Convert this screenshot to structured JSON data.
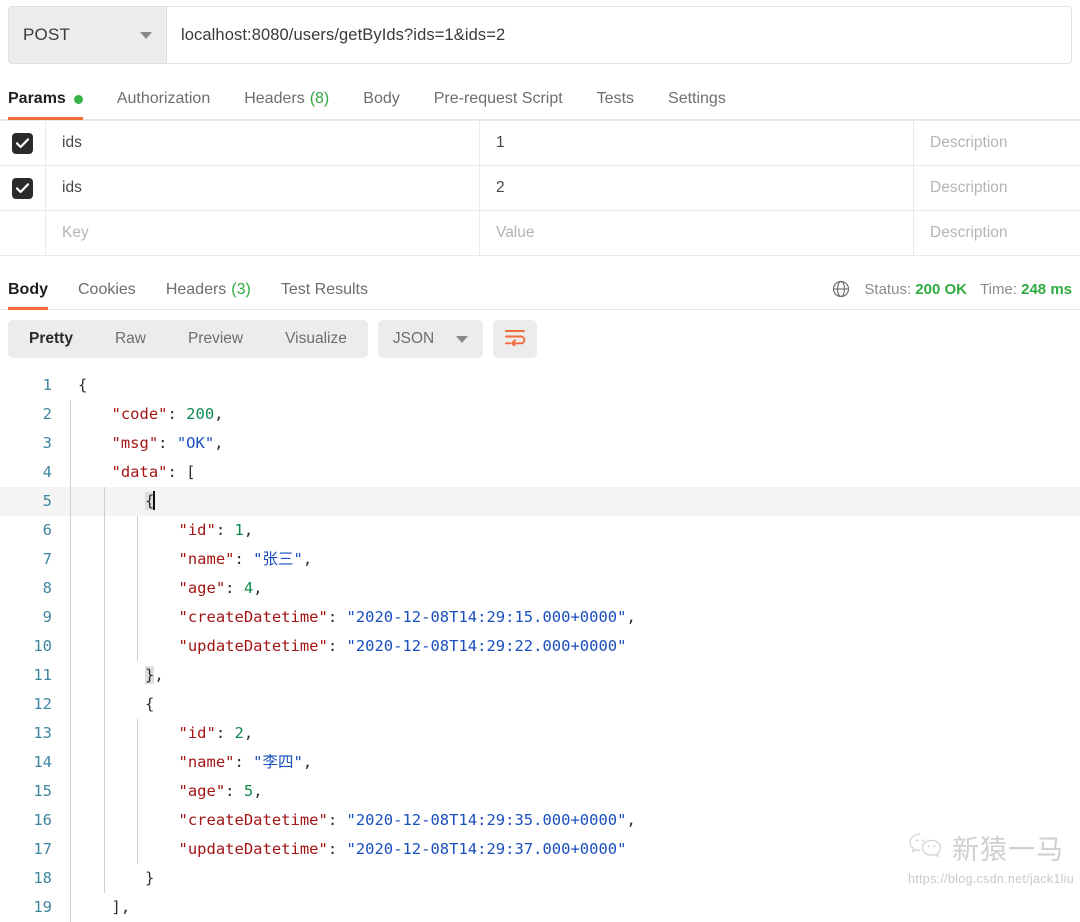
{
  "request": {
    "method": "POST",
    "url": "localhost:8080/users/getByIds?ids=1&ids=2",
    "method_caret_icon": "chevron-down-icon"
  },
  "request_tabs": [
    {
      "label": "Params",
      "badge": "",
      "dot": true,
      "active": true
    },
    {
      "label": "Authorization",
      "badge": "",
      "dot": false,
      "active": false
    },
    {
      "label": "Headers",
      "badge": "(8)",
      "dot": false,
      "active": false
    },
    {
      "label": "Body",
      "badge": "",
      "dot": false,
      "active": false
    },
    {
      "label": "Pre-request Script",
      "badge": "",
      "dot": false,
      "active": false
    },
    {
      "label": "Tests",
      "badge": "",
      "dot": false,
      "active": false
    },
    {
      "label": "Settings",
      "badge": "",
      "dot": false,
      "active": false
    }
  ],
  "params": {
    "placeholders": {
      "key": "Key",
      "value": "Value",
      "description": "Description"
    },
    "rows": [
      {
        "checked": true,
        "key": "ids",
        "value": "1",
        "description": ""
      },
      {
        "checked": true,
        "key": "ids",
        "value": "2",
        "description": ""
      },
      {
        "checked": false,
        "key": "",
        "value": "",
        "description": ""
      }
    ]
  },
  "response_tabs": [
    {
      "label": "Body",
      "badge": "",
      "active": true
    },
    {
      "label": "Cookies",
      "badge": "",
      "active": false
    },
    {
      "label": "Headers",
      "badge": "(3)",
      "active": false
    },
    {
      "label": "Test Results",
      "badge": "",
      "active": false
    }
  ],
  "response_meta": {
    "globe_icon": "globe-icon",
    "status_label": "Status:",
    "status_value": "200 OK",
    "time_label": "Time:",
    "time_value": "248 ms"
  },
  "view_toolbar": {
    "modes": [
      {
        "label": "Pretty",
        "active": true
      },
      {
        "label": "Raw",
        "active": false
      },
      {
        "label": "Preview",
        "active": false
      },
      {
        "label": "Visualize",
        "active": false
      }
    ],
    "format": "JSON",
    "format_caret_icon": "chevron-down-icon",
    "wrap_icon": "word-wrap-icon"
  },
  "response_body": {
    "lines": [
      {
        "n": "1",
        "indent": 0,
        "guides": 0,
        "highlight": false,
        "tokens": [
          {
            "t": "{",
            "c": "jpunc"
          }
        ]
      },
      {
        "n": "2",
        "indent": 1,
        "guides": 1,
        "highlight": false,
        "tokens": [
          {
            "t": "\"code\"",
            "c": "jkey"
          },
          {
            "t": ": ",
            "c": "jpunc"
          },
          {
            "t": "200",
            "c": "jnum"
          },
          {
            "t": ",",
            "c": "jpunc"
          }
        ]
      },
      {
        "n": "3",
        "indent": 1,
        "guides": 1,
        "highlight": false,
        "tokens": [
          {
            "t": "\"msg\"",
            "c": "jkey"
          },
          {
            "t": ": ",
            "c": "jpunc"
          },
          {
            "t": "\"OK\"",
            "c": "jstr"
          },
          {
            "t": ",",
            "c": "jpunc"
          }
        ]
      },
      {
        "n": "4",
        "indent": 1,
        "guides": 1,
        "highlight": false,
        "tokens": [
          {
            "t": "\"data\"",
            "c": "jkey"
          },
          {
            "t": ": ",
            "c": "jpunc"
          },
          {
            "t": "[",
            "c": "jpunc"
          }
        ]
      },
      {
        "n": "5",
        "indent": 2,
        "guides": 2,
        "highlight": true,
        "caret": true,
        "tokens": [
          {
            "t": "{",
            "c": "jpunc brk"
          }
        ]
      },
      {
        "n": "6",
        "indent": 3,
        "guides": 3,
        "highlight": false,
        "tokens": [
          {
            "t": "\"id\"",
            "c": "jkey"
          },
          {
            "t": ": ",
            "c": "jpunc"
          },
          {
            "t": "1",
            "c": "jnum"
          },
          {
            "t": ",",
            "c": "jpunc"
          }
        ]
      },
      {
        "n": "7",
        "indent": 3,
        "guides": 3,
        "highlight": false,
        "tokens": [
          {
            "t": "\"name\"",
            "c": "jkey"
          },
          {
            "t": ": ",
            "c": "jpunc"
          },
          {
            "t": "\"张三\"",
            "c": "jstr"
          },
          {
            "t": ",",
            "c": "jpunc"
          }
        ]
      },
      {
        "n": "8",
        "indent": 3,
        "guides": 3,
        "highlight": false,
        "tokens": [
          {
            "t": "\"age\"",
            "c": "jkey"
          },
          {
            "t": ": ",
            "c": "jpunc"
          },
          {
            "t": "4",
            "c": "jnum"
          },
          {
            "t": ",",
            "c": "jpunc"
          }
        ]
      },
      {
        "n": "9",
        "indent": 3,
        "guides": 3,
        "highlight": false,
        "tokens": [
          {
            "t": "\"createDatetime\"",
            "c": "jkey"
          },
          {
            "t": ": ",
            "c": "jpunc"
          },
          {
            "t": "\"2020-12-08T14:29:15.000+0000\"",
            "c": "jstr"
          },
          {
            "t": ",",
            "c": "jpunc"
          }
        ]
      },
      {
        "n": "10",
        "indent": 3,
        "guides": 3,
        "highlight": false,
        "tokens": [
          {
            "t": "\"updateDatetime\"",
            "c": "jkey"
          },
          {
            "t": ": ",
            "c": "jpunc"
          },
          {
            "t": "\"2020-12-08T14:29:22.000+0000\"",
            "c": "jstr"
          }
        ]
      },
      {
        "n": "11",
        "indent": 2,
        "guides": 2,
        "highlight": false,
        "tokens": [
          {
            "t": "}",
            "c": "jpunc brk"
          },
          {
            "t": ",",
            "c": "jpunc"
          }
        ]
      },
      {
        "n": "12",
        "indent": 2,
        "guides": 2,
        "highlight": false,
        "tokens": [
          {
            "t": "{",
            "c": "jpunc"
          }
        ]
      },
      {
        "n": "13",
        "indent": 3,
        "guides": 3,
        "highlight": false,
        "tokens": [
          {
            "t": "\"id\"",
            "c": "jkey"
          },
          {
            "t": ": ",
            "c": "jpunc"
          },
          {
            "t": "2",
            "c": "jnum"
          },
          {
            "t": ",",
            "c": "jpunc"
          }
        ]
      },
      {
        "n": "14",
        "indent": 3,
        "guides": 3,
        "highlight": false,
        "tokens": [
          {
            "t": "\"name\"",
            "c": "jkey"
          },
          {
            "t": ": ",
            "c": "jpunc"
          },
          {
            "t": "\"李四\"",
            "c": "jstr"
          },
          {
            "t": ",",
            "c": "jpunc"
          }
        ]
      },
      {
        "n": "15",
        "indent": 3,
        "guides": 3,
        "highlight": false,
        "tokens": [
          {
            "t": "\"age\"",
            "c": "jkey"
          },
          {
            "t": ": ",
            "c": "jpunc"
          },
          {
            "t": "5",
            "c": "jnum"
          },
          {
            "t": ",",
            "c": "jpunc"
          }
        ]
      },
      {
        "n": "16",
        "indent": 3,
        "guides": 3,
        "highlight": false,
        "tokens": [
          {
            "t": "\"createDatetime\"",
            "c": "jkey"
          },
          {
            "t": ": ",
            "c": "jpunc"
          },
          {
            "t": "\"2020-12-08T14:29:35.000+0000\"",
            "c": "jstr"
          },
          {
            "t": ",",
            "c": "jpunc"
          }
        ]
      },
      {
        "n": "17",
        "indent": 3,
        "guides": 3,
        "highlight": false,
        "tokens": [
          {
            "t": "\"updateDatetime\"",
            "c": "jkey"
          },
          {
            "t": ": ",
            "c": "jpunc"
          },
          {
            "t": "\"2020-12-08T14:29:37.000+0000\"",
            "c": "jstr"
          }
        ]
      },
      {
        "n": "18",
        "indent": 2,
        "guides": 2,
        "highlight": false,
        "tokens": [
          {
            "t": "}",
            "c": "jpunc"
          }
        ]
      },
      {
        "n": "19",
        "indent": 1,
        "guides": 1,
        "highlight": false,
        "tokens": [
          {
            "t": "]",
            "c": "jpunc"
          },
          {
            "t": ",",
            "c": "jpunc"
          }
        ]
      }
    ]
  },
  "watermark": {
    "icon": "wechat-icon",
    "name": "新猿一马",
    "url": "https://blog.csdn.net/jack1liu"
  }
}
